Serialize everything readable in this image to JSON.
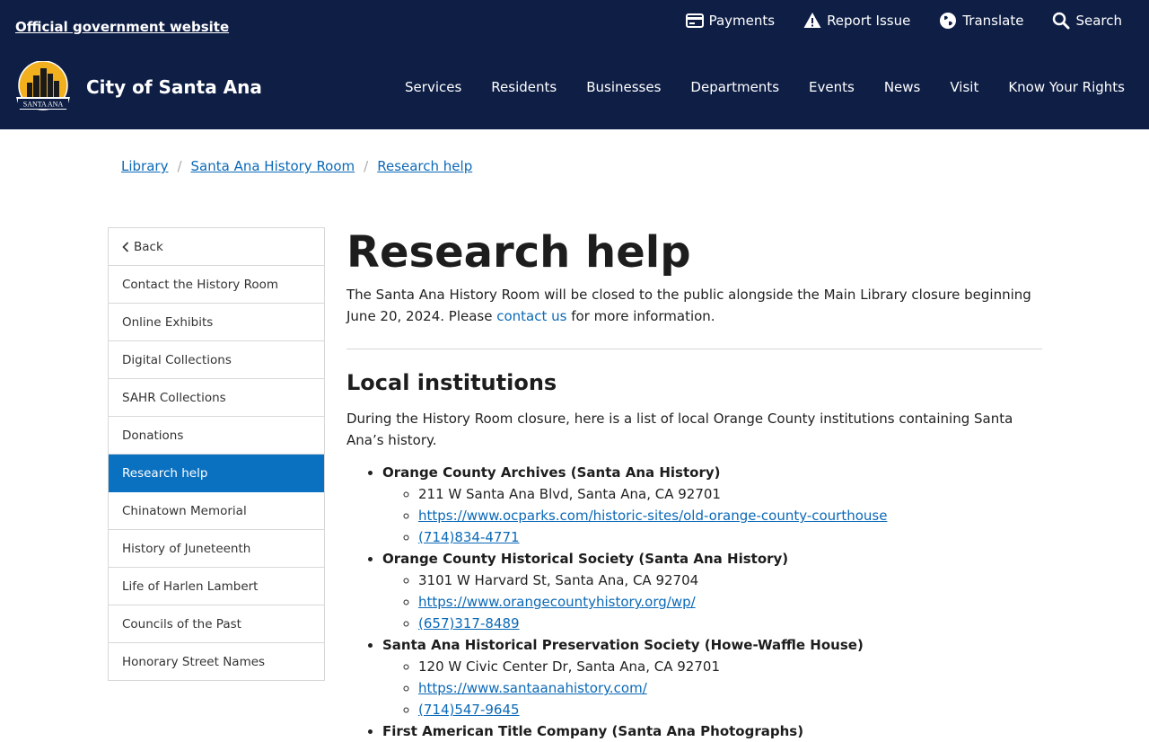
{
  "header": {
    "official": "Official government website",
    "site_name": "City of Santa Ana",
    "logo_text": "SANTA ANA",
    "utility": [
      {
        "label": "Payments",
        "icon": "credit-card-icon"
      },
      {
        "label": "Report Issue",
        "icon": "warning-icon"
      },
      {
        "label": "Translate",
        "icon": "globe-icon"
      },
      {
        "label": "Search",
        "icon": "search-icon"
      }
    ],
    "nav": [
      "Services",
      "Residents",
      "Businesses",
      "Departments",
      "Events",
      "News",
      "Visit",
      "Know Your Rights"
    ]
  },
  "breadcrumb": [
    "Library",
    "Santa Ana History Room",
    "Research help"
  ],
  "sidebar": {
    "back": "Back",
    "items": [
      "Contact the History Room",
      "Online Exhibits",
      "Digital Collections",
      "SAHR Collections",
      "Donations",
      "Research help",
      "Chinatown Memorial",
      "History of Juneteenth",
      "Life of Harlen Lambert",
      "Councils of the Past",
      "Honorary Street Names"
    ],
    "active": "Research help"
  },
  "main": {
    "title": "Research help",
    "intro_before": "The Santa Ana History Room will be closed to the public alongside the Main Library closure beginning June 20, 2024. Please ",
    "intro_link": "contact us",
    "intro_after": " for more information.",
    "section_title": "Local institutions",
    "section_desc": "During the History Room closure, here is a list of local Orange County institutions containing Santa Ana’s history.",
    "institutions": [
      {
        "name": "Orange County Archives (Santa Ana History)",
        "address": "211 W Santa Ana Blvd, Santa Ana, CA 92701",
        "url": "https://www.ocparks.com/historic-sites/old-orange-county-courthouse",
        "phone": "(714)834-4771"
      },
      {
        "name": "Orange County Historical Society (Santa Ana History)",
        "address": "3101 W Harvard St, Santa Ana, CA 92704",
        "url": "https://www.orangecountyhistory.org/wp/",
        "phone": "(657)317-8489"
      },
      {
        "name": "Santa Ana Historical Preservation Society (Howe-Waffle House)",
        "address": "120 W Civic Center Dr, Santa Ana, CA 92701",
        "url": "https://www.santaanahistory.com/",
        "phone": "(714)547-9645"
      },
      {
        "name": "First American Title Company (Santa Ana Photographs)"
      }
    ]
  },
  "colors": {
    "header_bg": "#0e1e45",
    "link": "#0b69b7",
    "active_bg": "#0a70c0",
    "logo_gold": "#f2b01e"
  }
}
